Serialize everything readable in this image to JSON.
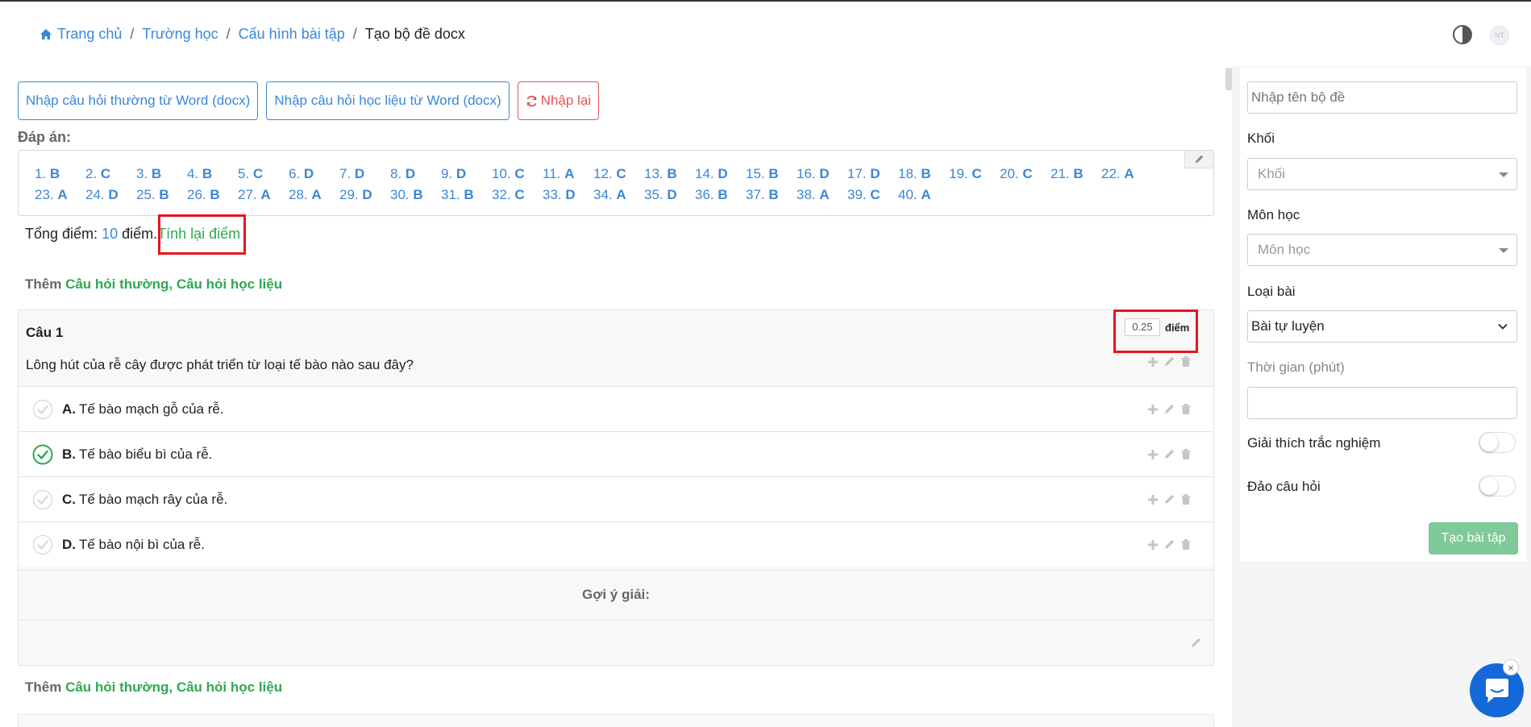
{
  "breadcrumb": {
    "home": "Trang chủ",
    "school": "Trường học",
    "config": "Cấu hình bài tập",
    "current": "Tạo bộ đề docx"
  },
  "header": {
    "avatar_text": "NT"
  },
  "toolbar": {
    "import_normal": "Nhập câu hỏi thường từ Word (docx)",
    "import_material": "Nhập câu hỏi học liệu từ Word (docx)",
    "reset": "Nhập lại"
  },
  "answers": {
    "label": "Đáp án:",
    "items": [
      {
        "n": "1.",
        "a": "B"
      },
      {
        "n": "2.",
        "a": "C"
      },
      {
        "n": "3.",
        "a": "B"
      },
      {
        "n": "4.",
        "a": "B"
      },
      {
        "n": "5.",
        "a": "C"
      },
      {
        "n": "6.",
        "a": "D"
      },
      {
        "n": "7.",
        "a": "D"
      },
      {
        "n": "8.",
        "a": "D"
      },
      {
        "n": "9.",
        "a": "D"
      },
      {
        "n": "10.",
        "a": "C"
      },
      {
        "n": "11.",
        "a": "A"
      },
      {
        "n": "12.",
        "a": "C"
      },
      {
        "n": "13.",
        "a": "B"
      },
      {
        "n": "14.",
        "a": "D"
      },
      {
        "n": "15.",
        "a": "B"
      },
      {
        "n": "16.",
        "a": "D"
      },
      {
        "n": "17.",
        "a": "D"
      },
      {
        "n": "18.",
        "a": "B"
      },
      {
        "n": "19.",
        "a": "C"
      },
      {
        "n": "20.",
        "a": "C"
      },
      {
        "n": "21.",
        "a": "B"
      },
      {
        "n": "22.",
        "a": "A"
      },
      {
        "n": "23.",
        "a": "A"
      },
      {
        "n": "24.",
        "a": "D"
      },
      {
        "n": "25.",
        "a": "B"
      },
      {
        "n": "26.",
        "a": "B"
      },
      {
        "n": "27.",
        "a": "A"
      },
      {
        "n": "28.",
        "a": "A"
      },
      {
        "n": "29.",
        "a": "D"
      },
      {
        "n": "30.",
        "a": "B"
      },
      {
        "n": "31.",
        "a": "B"
      },
      {
        "n": "32.",
        "a": "C"
      },
      {
        "n": "33.",
        "a": "D"
      },
      {
        "n": "34.",
        "a": "A"
      },
      {
        "n": "35.",
        "a": "D"
      },
      {
        "n": "36.",
        "a": "B"
      },
      {
        "n": "37.",
        "a": "B"
      },
      {
        "n": "38.",
        "a": "A"
      },
      {
        "n": "39.",
        "a": "C"
      },
      {
        "n": "40.",
        "a": "A"
      }
    ]
  },
  "total": {
    "prefix": "Tổng điểm:",
    "value": "10",
    "suffix": "điểm.",
    "recalc": "Tính lại điểm"
  },
  "add_question": {
    "prefix": "Thêm",
    "normal": "Câu hỏi thường,",
    "material": "Câu hỏi học liệu"
  },
  "question": {
    "title": "Câu 1",
    "points_value": "0.25",
    "points_unit": "điểm",
    "text": "Lông hút của rễ cây được phát triển từ loại tế bào nào sau đây?",
    "options": [
      {
        "key": "A.",
        "text": "Tế bào mạch gỗ của rễ.",
        "correct": false
      },
      {
        "key": "B.",
        "text": "Tế bào biểu bì của rễ.",
        "correct": true
      },
      {
        "key": "C.",
        "text": "Tế bào mạch rây của rễ.",
        "correct": false
      },
      {
        "key": "D.",
        "text": "Tế bào nội bì của rễ.",
        "correct": false
      }
    ],
    "hint_title": "Gợi ý giải:"
  },
  "sidebar": {
    "name_placeholder": "Nhập tên bộ đề",
    "grade_label": "Khối",
    "grade_placeholder": "Khối",
    "subject_label": "Môn học",
    "subject_placeholder": "Môn học",
    "type_label": "Loại bài",
    "type_value": "Bài tự luyện",
    "time_label": "Thời gian (phút)",
    "explain_label": "Giải thích trắc nghiệm",
    "explain_on": false,
    "shuffle_label": "Đảo câu hỏi",
    "shuffle_on": false,
    "create_button": "Tạo bài tập"
  },
  "colors": {
    "link_blue": "#3a87d6",
    "accent_green": "#2fa84f",
    "danger_red": "#e05656",
    "highlight_red": "#e8141f",
    "chat_blue": "#1568d8"
  }
}
